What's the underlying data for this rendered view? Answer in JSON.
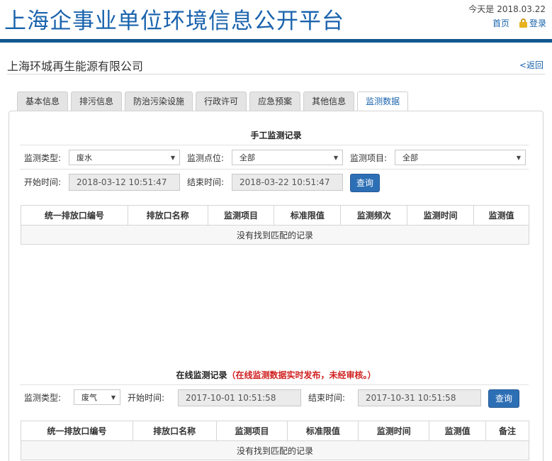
{
  "header": {
    "site_title": "上海企事业单位环境信息公开平台",
    "today_label": "今天是",
    "today_date": "2018.03.22",
    "home_link": "首页",
    "login_link": "登录"
  },
  "company": {
    "name": "上海环城再生能源有限公司",
    "back_link": "<返回"
  },
  "tabs": [
    {
      "label": "基本信息"
    },
    {
      "label": "排污信息"
    },
    {
      "label": "防治污染设施"
    },
    {
      "label": "行政许可"
    },
    {
      "label": "应急预案"
    },
    {
      "label": "其他信息"
    },
    {
      "label": "监测数据",
      "active": true
    }
  ],
  "manual": {
    "title": "手工监测记录",
    "type_label": "监测类型:",
    "type_value": "废水",
    "point_label": "监测点位:",
    "point_value": "全部",
    "item_label": "监测项目:",
    "item_value": "全部",
    "start_label": "开始时间:",
    "start_value": "2018-03-12 10:51:47",
    "end_label": "结束时间:",
    "end_value": "2018-03-22 10:51:47",
    "query_button": "查询",
    "columns": [
      "统一排放口编号",
      "排放口名称",
      "监测项目",
      "标准限值",
      "监测频次",
      "监测时间",
      "监测值"
    ],
    "empty_text": "没有找到匹配的记录"
  },
  "online": {
    "title": "在线监测记录",
    "warning": "（在线监测数据实时发布，未经审核。）",
    "type_label": "监测类型:",
    "type_value": "废气",
    "start_label": "开始时间:",
    "start_value": "2017-10-01 10:51:58",
    "end_label": "结束时间:",
    "end_value": "2017-10-31 10:51:58",
    "query_button": "查询",
    "columns": [
      "统一排放口编号",
      "排放口名称",
      "监测项目",
      "标准限值",
      "监测时间",
      "监测值",
      "备注"
    ],
    "empty_text": "没有找到匹配的记录"
  },
  "icons": {
    "dropdown": "caret-down-icon",
    "login": "lock-icon"
  },
  "colors": {
    "brand_blue": "#1a63ad",
    "header_bar": "#13588f",
    "button_blue": "#2d6fb5",
    "warning_red": "#d02020"
  }
}
